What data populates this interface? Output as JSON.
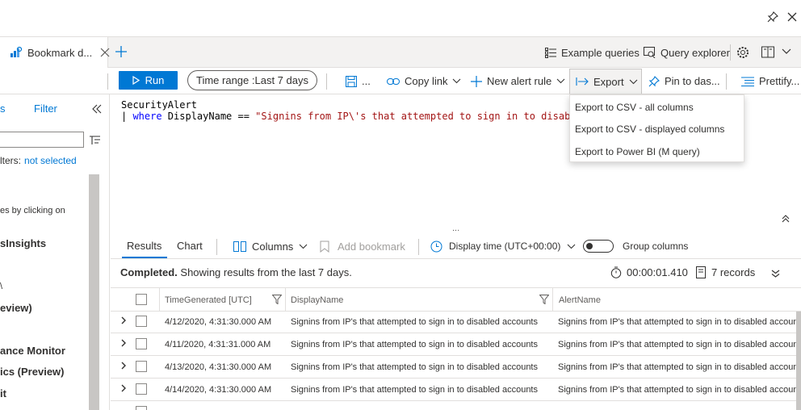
{
  "tab": {
    "label": "Bookmark d..."
  },
  "tabbar_tools": {
    "example_queries": "Example queries",
    "query_explorer": "Query explorer"
  },
  "toolbar": {
    "run": "Run",
    "time_range_prefix": "Time range : ",
    "time_range_value": "Last 7 days",
    "save_ellipsis": "...",
    "copy_link": "Copy link",
    "new_alert_rule": "New alert rule",
    "export": "Export",
    "pin_to": "Pin to das...",
    "prettify": "Prettify..."
  },
  "export_menu": {
    "items": [
      "Export to CSV - all columns",
      "Export to CSV - displayed columns",
      "Export to Power BI (M query)"
    ]
  },
  "left_panel": {
    "tab_fragment": "s",
    "filter": "Filter",
    "filters_label": "lters:",
    "filters_value": "not selected",
    "hint": "es by clicking on",
    "items": [
      "sInsights",
      "\\",
      "eview)",
      "ance Monitor",
      "ics (Preview)",
      "it"
    ]
  },
  "editor": {
    "line1": "SecurityAlert",
    "line2_pipe": "| ",
    "line2_kw": "where",
    "line2_field": " DisplayName == ",
    "line2_str": "\"Signins from IP\\'s that attempted to sign in to disable"
  },
  "results_bar": {
    "results": "Results",
    "chart": "Chart",
    "columns": "Columns",
    "add_bookmark": "Add bookmark",
    "display_time": "Display time (UTC+00:00)",
    "group_columns": "Group columns"
  },
  "status": {
    "completed": "Completed.",
    "message": " Showing results from the last 7 days.",
    "duration": "00:00:01.410",
    "records": "7 records"
  },
  "grid": {
    "headers": [
      "TimeGenerated [UTC]",
      "DisplayName",
      "AlertName"
    ],
    "rows": [
      [
        "4/12/2020, 4:31:30.000 AM",
        "Signins from IP's that attempted to sign in to disabled accounts",
        "Signins from IP's that attempted to sign in to disabled accounts"
      ],
      [
        "4/11/2020, 4:31:31.000 AM",
        "Signins from IP's that attempted to sign in to disabled accounts",
        "Signins from IP's that attempted to sign in to disabled accounts"
      ],
      [
        "4/13/2020, 4:31:30.000 AM",
        "Signins from IP's that attempted to sign in to disabled accounts",
        "Signins from IP's that attempted to sign in to disabled accounts"
      ],
      [
        "4/14/2020, 4:31:30.000 AM",
        "Signins from IP's that attempted to sign in to disabled accounts",
        "Signins from IP's that attempted to sign in to disabled accounts"
      ]
    ]
  },
  "colors": {
    "accent": "#0078d4",
    "string": "#a31515",
    "keyword": "#0000ff"
  }
}
